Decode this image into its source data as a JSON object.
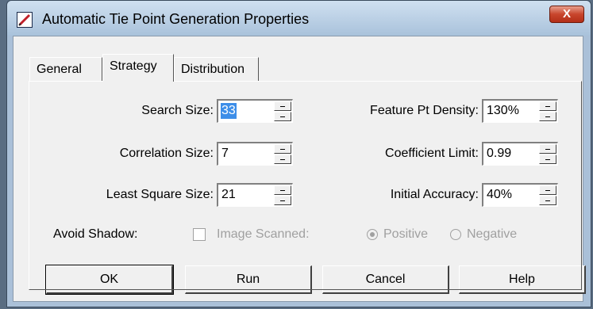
{
  "window": {
    "title": "Automatic Tie Point Generation Properties",
    "close_label": "X"
  },
  "tabs": [
    {
      "label": "General",
      "active": false
    },
    {
      "label": "Strategy",
      "active": true
    },
    {
      "label": "Distribution",
      "active": false
    }
  ],
  "fields": {
    "search_size": {
      "label": "Search Size:",
      "value": "33"
    },
    "correlation_size": {
      "label": "Correlation Size:",
      "value": "7"
    },
    "least_square_size": {
      "label": "Least Square Size:",
      "value": "21"
    },
    "feature_pt_density": {
      "label": "Feature Pt Density:",
      "value": "130%"
    },
    "coefficient_limit": {
      "label": "Coefficient Limit:",
      "value": "0.99"
    },
    "initial_accuracy": {
      "label": "Initial Accuracy:",
      "value": "40%"
    }
  },
  "avoid_shadow": {
    "label": "Avoid Shadow:",
    "checked": false,
    "image_scanned_label": "Image Scanned:",
    "positive_label": "Positive",
    "negative_label": "Negative",
    "selected": "Positive"
  },
  "buttons": {
    "ok": "OK",
    "run": "Run",
    "cancel": "Cancel",
    "help": "Help"
  },
  "colors": {
    "selection": "#3d8ee8",
    "disabled_text": "#a0a0a0",
    "close_button": "#c8452c"
  }
}
